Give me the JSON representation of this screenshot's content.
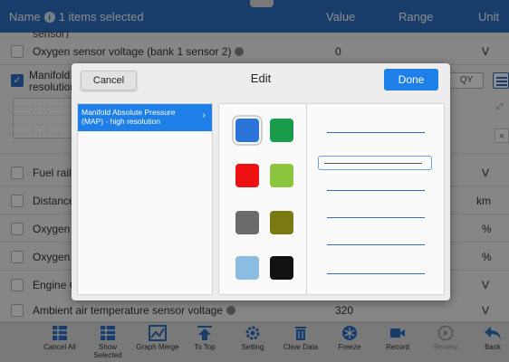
{
  "header": {
    "name_label": "Name",
    "selected_text": "1 items selected",
    "value_label": "Value",
    "range_label": "Range",
    "unit_label": "Unit"
  },
  "rows": [
    {
      "label": "sensor)",
      "value": "",
      "unit": "",
      "checked": false
    },
    {
      "label": "Oxygen sensor voltage (bank 1 sensor 2)",
      "value": "0",
      "unit": "V",
      "checked": false
    },
    {
      "label": "Manifold",
      "label2": "resolution",
      "value": "",
      "unit": "",
      "checked": true
    },
    {
      "label": "Fuel rail",
      "value": "",
      "unit": "V",
      "checked": false
    },
    {
      "label": "Distance",
      "value": "",
      "unit": "km",
      "checked": false
    },
    {
      "label": "Oxygen",
      "value": "",
      "unit": "%",
      "checked": false
    },
    {
      "label": "Oxygen",
      "value": "",
      "unit": "%",
      "checked": false
    },
    {
      "label": "Engine C",
      "value": "",
      "unit": "V",
      "checked": false
    },
    {
      "label": "Ambient air temperature sensor voltage",
      "value": "320",
      "unit": "V",
      "checked": false
    }
  ],
  "graph_tools": {
    "zoom_label": "QY"
  },
  "dialog": {
    "title": "Edit",
    "cancel_label": "Cancel",
    "done_label": "Done",
    "parameter": "Manifold Absolute Pressure (MAP) - high resolution",
    "chevron": "›",
    "colors": [
      "#2a73d9",
      "#1a9a4b",
      "#ee1111",
      "#8cc63e",
      "#6b6b6b",
      "#7a7a12",
      "#8bbde0",
      "#111111"
    ],
    "selected_color_index": 0,
    "line_styles": [
      "solid",
      "solid",
      "solid",
      "solid",
      "solid",
      "solid"
    ],
    "selected_line_index": 1
  },
  "toolbar": {
    "items": [
      {
        "label": "Cancel All",
        "icon": "grid-icon"
      },
      {
        "label": "Show Selected",
        "icon": "grid-icon"
      },
      {
        "label": "Graph Merge",
        "icon": "graph-icon"
      },
      {
        "label": "To Top",
        "icon": "arrow-up-icon"
      },
      {
        "label": "Setting",
        "icon": "gear-icon"
      },
      {
        "label": "Clear Data",
        "icon": "trash-icon"
      },
      {
        "label": "Freeze",
        "icon": "snowflake-icon"
      },
      {
        "label": "Record",
        "icon": "video-camera-icon"
      },
      {
        "label": "Review",
        "icon": "play-icon"
      },
      {
        "label": "Back",
        "icon": "back-arrow-icon"
      }
    ]
  },
  "colors": {
    "header_bg": "#2f6fc4",
    "accent": "#1e7fe8"
  }
}
